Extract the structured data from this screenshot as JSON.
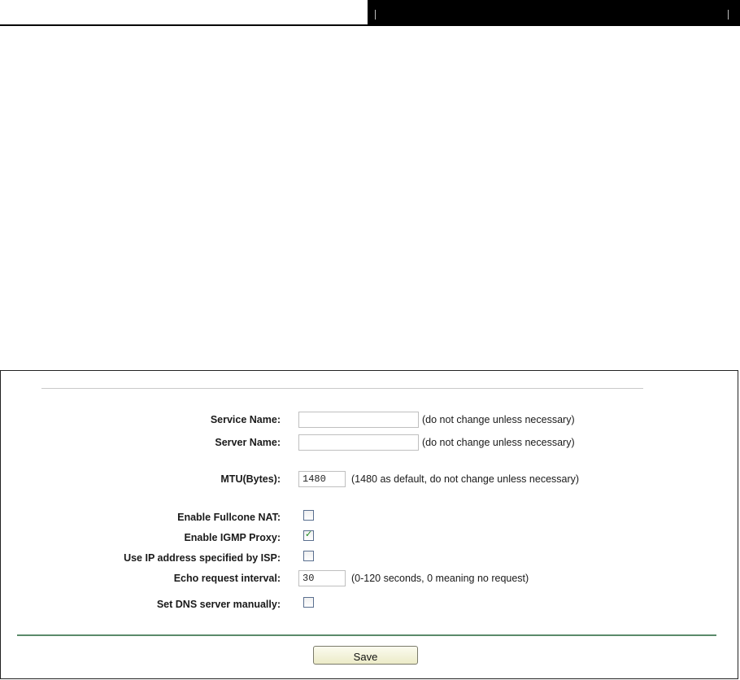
{
  "form": {
    "service_name": {
      "label": "Service Name:",
      "value": "",
      "hint": "(do not change unless necessary)"
    },
    "server_name": {
      "label": "Server Name:",
      "value": "",
      "hint": "(do not change unless necessary)"
    },
    "mtu": {
      "label": "MTU(Bytes):",
      "value": "1480",
      "hint": "(1480 as default, do not change unless necessary)"
    },
    "fullcone_nat": {
      "label": "Enable Fullcone NAT:",
      "checked": false
    },
    "igmp_proxy": {
      "label": "Enable IGMP Proxy:",
      "checked": true
    },
    "use_isp_ip": {
      "label": "Use IP address specified by ISP:",
      "checked": false
    },
    "echo_interval": {
      "label": "Echo request interval:",
      "value": "30",
      "hint": "(0-120 seconds, 0 meaning no request)"
    },
    "manual_dns": {
      "label": "Set DNS server manually:",
      "checked": false
    }
  },
  "save_label": "Save",
  "icons": {
    "checkmark": "check-icon"
  },
  "colors": {
    "button_top": "#fbfbef",
    "button_bottom": "#ecebc8",
    "divider": "#5a8a6a",
    "check": "#1f8a1f"
  }
}
